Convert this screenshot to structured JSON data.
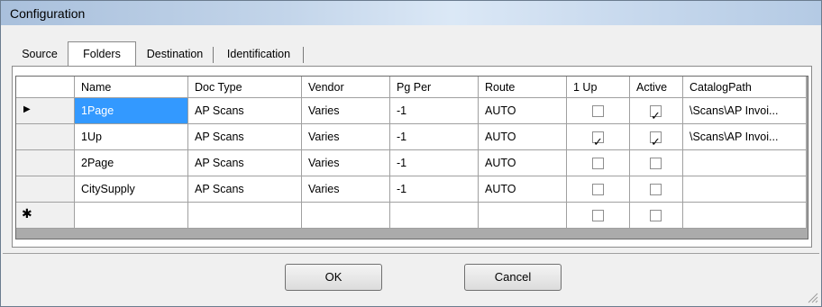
{
  "window": {
    "title": "Configuration"
  },
  "tabs": [
    {
      "label": "Source",
      "selected": false
    },
    {
      "label": "Folders",
      "selected": true
    },
    {
      "label": "Destination",
      "selected": false
    },
    {
      "label": "Identification",
      "selected": false
    }
  ],
  "grid": {
    "columns": [
      "Name",
      "Doc Type",
      "Vendor",
      "Pg Per",
      "Route",
      "1 Up",
      "Active",
      "CatalogPath"
    ],
    "rows": [
      {
        "name": "1Page",
        "doc_type": "AP Scans",
        "vendor": "Varies",
        "pg_per": "-1",
        "route": "AUTO",
        "one_up": false,
        "active": true,
        "catalog_path": "\\Scans\\AP Invoi...",
        "current": true
      },
      {
        "name": "1Up",
        "doc_type": "AP Scans",
        "vendor": "Varies",
        "pg_per": "-1",
        "route": "AUTO",
        "one_up": true,
        "active": true,
        "catalog_path": "\\Scans\\AP Invoi...",
        "current": false
      },
      {
        "name": "2Page",
        "doc_type": "AP Scans",
        "vendor": "Varies",
        "pg_per": "-1",
        "route": "AUTO",
        "one_up": false,
        "active": false,
        "catalog_path": "",
        "current": false
      },
      {
        "name": "CitySupply",
        "doc_type": "AP Scans",
        "vendor": "Varies",
        "pg_per": "-1",
        "route": "AUTO",
        "one_up": false,
        "active": false,
        "catalog_path": "",
        "current": false
      }
    ],
    "new_row_marker": "✱",
    "current_row_marker": "▶"
  },
  "buttons": {
    "ok": "OK",
    "cancel": "Cancel"
  },
  "colors": {
    "selection": "#3399ff",
    "grid_background": "#ababab"
  }
}
